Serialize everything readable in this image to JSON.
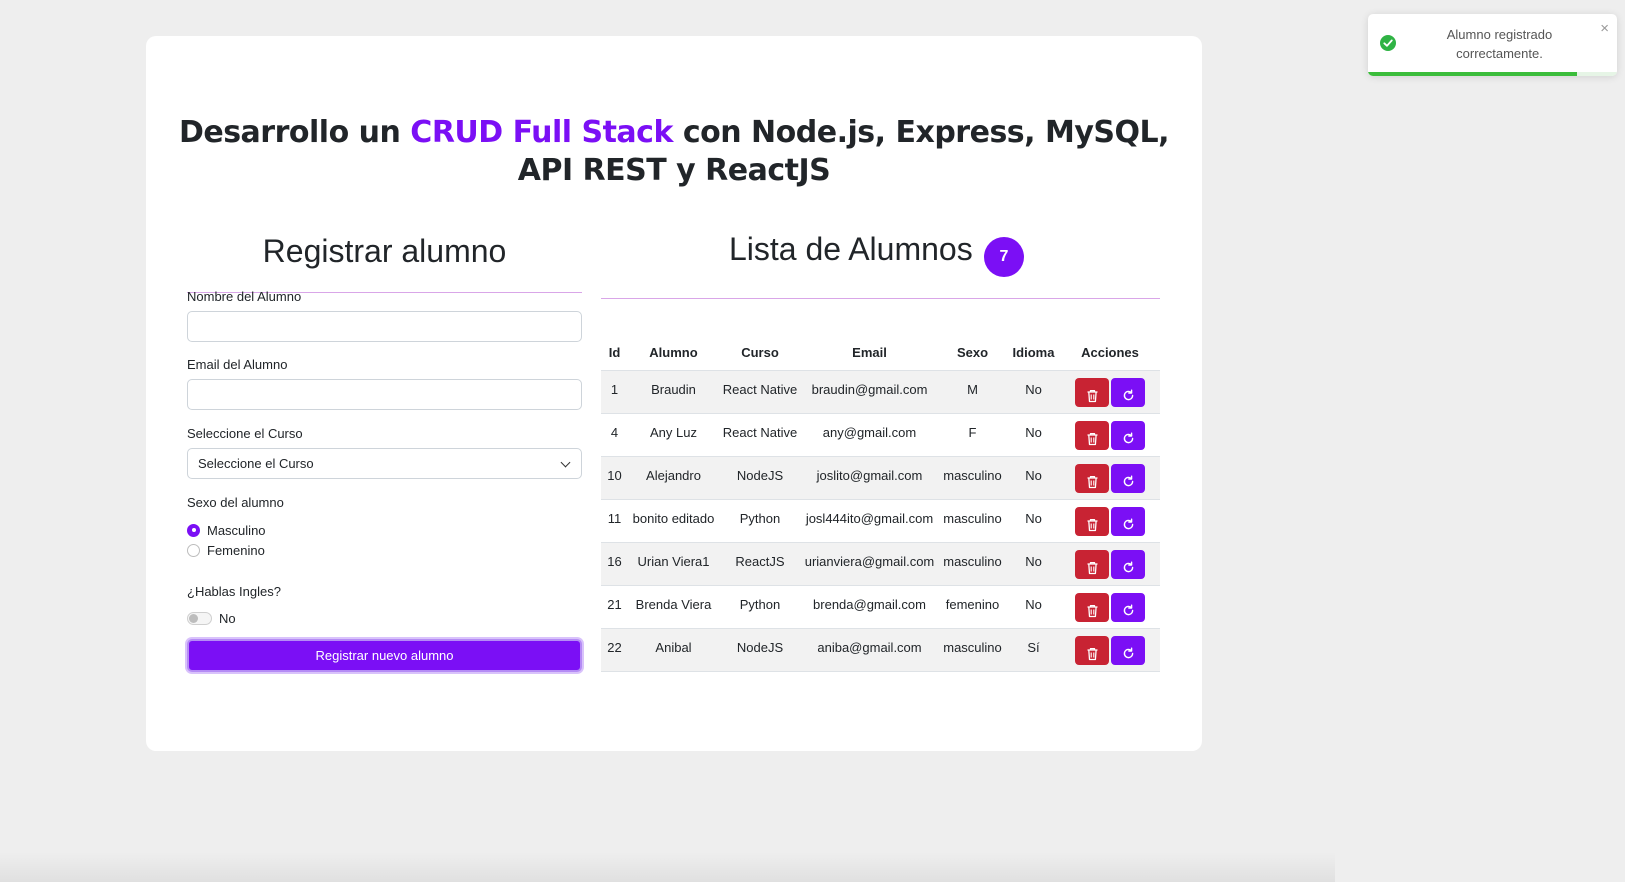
{
  "header": {
    "title_prefix": "Desarrollo un ",
    "title_accent": "CRUD Full Stack",
    "title_suffix_line1": " con Node.js, Express, MySQL,",
    "title_line2": "API REST y ReactJS",
    "accent_color": "#7b0ff5"
  },
  "form": {
    "title": "Registrar alumno",
    "name_label": "Nombre del Alumno",
    "name_value": "",
    "email_label": "Email del Alumno",
    "email_value": "",
    "course_label": "Seleccione el Curso",
    "course_selected": "Seleccione el Curso",
    "sex_label": "Sexo del alumno",
    "sex_options": [
      {
        "label": "Masculino",
        "checked": true
      },
      {
        "label": "Femenino",
        "checked": false
      }
    ],
    "english_label": "¿Hablas Ingles?",
    "english_toggle_label": "No",
    "english_on": false,
    "submit_label": "Registrar nuevo alumno"
  },
  "list": {
    "title": "Lista de Alumnos",
    "count": "7",
    "columns": [
      "Id",
      "Alumno",
      "Curso",
      "Email",
      "Sexo",
      "Idioma",
      "Acciones"
    ],
    "rows": [
      {
        "id": "1",
        "alumno": "Braudin",
        "curso": "React Native",
        "email": "braudin@gmail.com",
        "sexo": "M",
        "idioma": "No"
      },
      {
        "id": "4",
        "alumno": "Any Luz",
        "curso": "React Native",
        "email": "any@gmail.com",
        "sexo": "F",
        "idioma": "No"
      },
      {
        "id": "10",
        "alumno": "Alejandro",
        "curso": "NodeJS",
        "email": "joslito@gmail.com",
        "sexo": "masculino",
        "idioma": "No"
      },
      {
        "id": "11",
        "alumno": "bonito editado",
        "curso": "Python",
        "email": "josl444ito@gmail.com",
        "sexo": "masculino",
        "idioma": "No"
      },
      {
        "id": "16",
        "alumno": "Urian Viera1",
        "curso": "ReactJS",
        "email": "urianviera@gmail.com",
        "sexo": "masculino",
        "idioma": "No"
      },
      {
        "id": "21",
        "alumno": "Brenda Viera",
        "curso": "Python",
        "email": "brenda@gmail.com",
        "sexo": "femenino",
        "idioma": "No"
      },
      {
        "id": "22",
        "alumno": "Anibal",
        "curso": "NodeJS",
        "email": "aniba@gmail.com",
        "sexo": "masculino",
        "idioma": "Sí"
      }
    ],
    "delete_icon": "trash-icon",
    "update_icon": "refresh-icon",
    "delete_color": "#c82333",
    "update_color": "#7b0ff5"
  },
  "toast": {
    "message": "Alumno registrado correctamente.",
    "icon": "check-circle-icon",
    "close_icon": "close-icon",
    "close_glyph": "×",
    "progress": 0.84,
    "color": "#3bbd3b"
  }
}
